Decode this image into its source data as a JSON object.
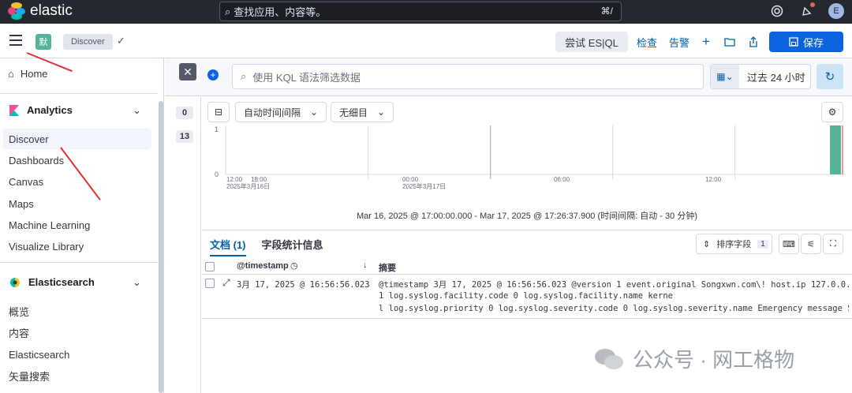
{
  "topbar": {
    "brand": "elastic",
    "search_placeholder": "查找应用、内容等。",
    "search_shortcut": "⌘/",
    "avatar_letter": "E"
  },
  "header": {
    "space_badge": "默",
    "breadcrumb": "Discover",
    "esql_button": "尝试 ES|QL",
    "inspect": "检查",
    "alerts": "告警",
    "save": "保存"
  },
  "sidebar": {
    "home": "Home",
    "analytics": {
      "title": "Analytics",
      "items": [
        "Discover",
        "Dashboards",
        "Canvas",
        "Maps",
        "Machine Learning",
        "Visualize Library"
      ]
    },
    "elasticsearch": {
      "title": "Elasticsearch",
      "items": [
        "概览",
        "内容",
        "Elasticsearch",
        "矢量搜索"
      ]
    }
  },
  "query": {
    "placeholder": "使用 KQL 语法筛选数据",
    "time_range": "过去 24 小时"
  },
  "field_counts": [
    "0",
    "13"
  ],
  "chart_controls": {
    "interval": "自动时间间隔",
    "breakdown": "无细目"
  },
  "chart_data": {
    "type": "bar",
    "yticks": [
      "1",
      "0"
    ],
    "x_ticks": [
      {
        "time": "12:00",
        "date": "2025年3月16日"
      },
      {
        "time": "18:00",
        "date": ""
      },
      {
        "time": "00:00",
        "date": "2025年3月17日"
      },
      {
        "time": "06:00",
        "date": ""
      },
      {
        "time": "12:00",
        "date": ""
      }
    ],
    "bars": [
      {
        "x": "2025-03-17 16:56",
        "value": 1,
        "color": "#54b399"
      }
    ],
    "timeline": "Mar 16, 2025 @ 17:00:00.000 - Mar 17, 2025 @ 17:26:37.900  (时间间隔: 自动 - 30 分钟)"
  },
  "docs": {
    "tab_docs": "文档 (1)",
    "tab_fields": "字段统计信息",
    "sort_label": "排序字段",
    "sort_count": "1",
    "col_timestamp": "@timestamp",
    "col_summary": "摘要",
    "row": {
      "timestamp": "3月 17, 2025 @ 16:56:56.023",
      "summary_line1": "@timestamp 3月 17, 2025 @ 16:56:56.023 @version 1 event.original Songxwn.com\\!  host.ip 127.0.0.",
      "summary_line2": "1 log.syslog.facility.code 0 log.syslog.facility.name kerne",
      "summary_line3": "l log.syslog.priority 0 log.syslog.severity.code 0 log.syslog.severity.name Emergency message S"
    }
  },
  "watermark": "公众号 · 网工格物"
}
